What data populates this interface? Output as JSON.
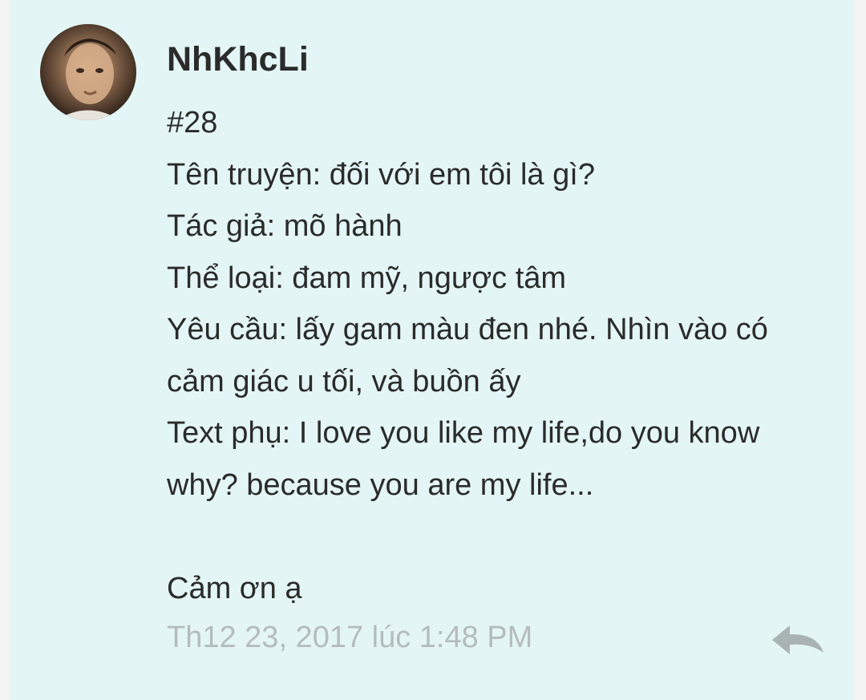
{
  "comment": {
    "username": "NhKhcLi",
    "lines": [
      "#28",
      "Tên truyện: đối với em tôi là gì?",
      "Tác giả: mõ hành",
      "Thể loại: đam mỹ, ngược tâm",
      "Yêu cầu: lấy gam màu đen nhé. Nhìn vào có",
      "cảm giác u tối, và buồn ấy",
      "Text phụ: I love you like my life,do you know",
      "why? because you are my life..."
    ],
    "closing": "Cảm ơn ạ",
    "timestamp": "Th12 23, 2017 lúc 1:48 PM"
  },
  "icons": {
    "avatar": "user-avatar-photo",
    "reply": "reply-arrow-icon"
  },
  "colors": {
    "card_background": "#e3f6f5",
    "text": "#2b2b2b",
    "timestamp": "#b5bcbd",
    "reply_icon": "#a9b3b4"
  }
}
